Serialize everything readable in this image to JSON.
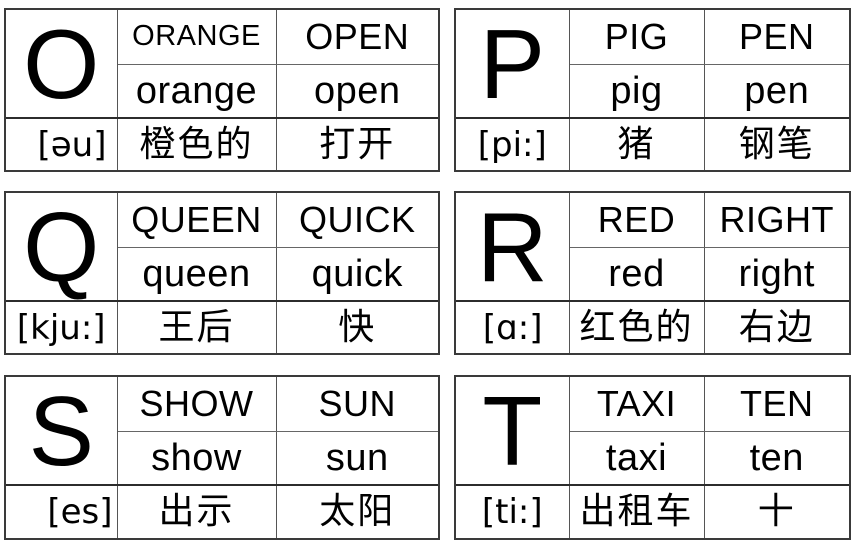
{
  "cards": [
    {
      "letter": "O",
      "phonetic": "[əu]",
      "words": [
        {
          "upper": "ORANGE",
          "lower": "orange",
          "chinese": "橙色的"
        },
        {
          "upper": "OPEN",
          "lower": "open",
          "chinese": "打开"
        }
      ]
    },
    {
      "letter": "P",
      "phonetic": "[pi:]",
      "words": [
        {
          "upper": "PIG",
          "lower": "pig",
          "chinese": "猪"
        },
        {
          "upper": "PEN",
          "lower": "pen",
          "chinese": "钢笔"
        }
      ]
    },
    {
      "letter": "Q",
      "phonetic": "[kju:]",
      "words": [
        {
          "upper": "QUEEN",
          "lower": "queen",
          "chinese": "王后"
        },
        {
          "upper": "QUICK",
          "lower": "quick",
          "chinese": "快"
        }
      ]
    },
    {
      "letter": "R",
      "phonetic": "[ɑ:]",
      "words": [
        {
          "upper": "RED",
          "lower": "red",
          "chinese": "红色的"
        },
        {
          "upper": "RIGHT",
          "lower": "right",
          "chinese": "右边"
        }
      ]
    },
    {
      "letter": "S",
      "phonetic": "[es]",
      "words": [
        {
          "upper": "SHOW",
          "lower": "show",
          "chinese": "出示"
        },
        {
          "upper": "SUN",
          "lower": "sun",
          "chinese": "太阳"
        }
      ]
    },
    {
      "letter": "T",
      "phonetic": "[ti:]",
      "words": [
        {
          "upper": "TAXI",
          "lower": "taxi",
          "chinese": "出租车"
        },
        {
          "upper": "TEN",
          "lower": "ten",
          "chinese": "十"
        }
      ]
    }
  ]
}
